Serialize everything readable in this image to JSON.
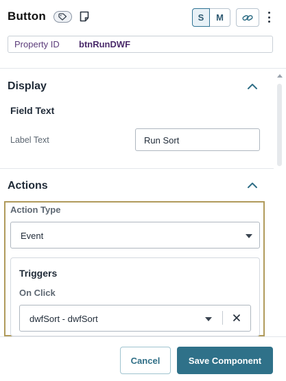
{
  "header": {
    "title": "Button",
    "size_options": [
      "S",
      "M"
    ],
    "selected_size": "S",
    "property_id_label": "Property ID",
    "property_id_value": "btnRunDWF"
  },
  "display": {
    "section_title": "Display",
    "field_text_heading": "Field Text",
    "label_text_label": "Label Text",
    "label_text_value": "Run Sort"
  },
  "actions": {
    "section_title": "Actions",
    "action_type_label": "Action Type",
    "action_type_value": "Event",
    "triggers_title": "Triggers",
    "on_click_label": "On Click",
    "on_click_value": "dwfSort - dwfSort"
  },
  "footer": {
    "cancel_label": "Cancel",
    "save_label": "Save Component"
  },
  "icons": {
    "tag": "tag-icon",
    "document": "document-icon",
    "link": "link-icon",
    "more": "kebab-menu-icon",
    "collapse": "chevron-up-icon",
    "dropdown": "caret-down-icon",
    "clear": "close-icon"
  },
  "colors": {
    "accent": "#2f7189",
    "property_text": "#4a2a6a",
    "highlight_border": "#b09a5a"
  }
}
